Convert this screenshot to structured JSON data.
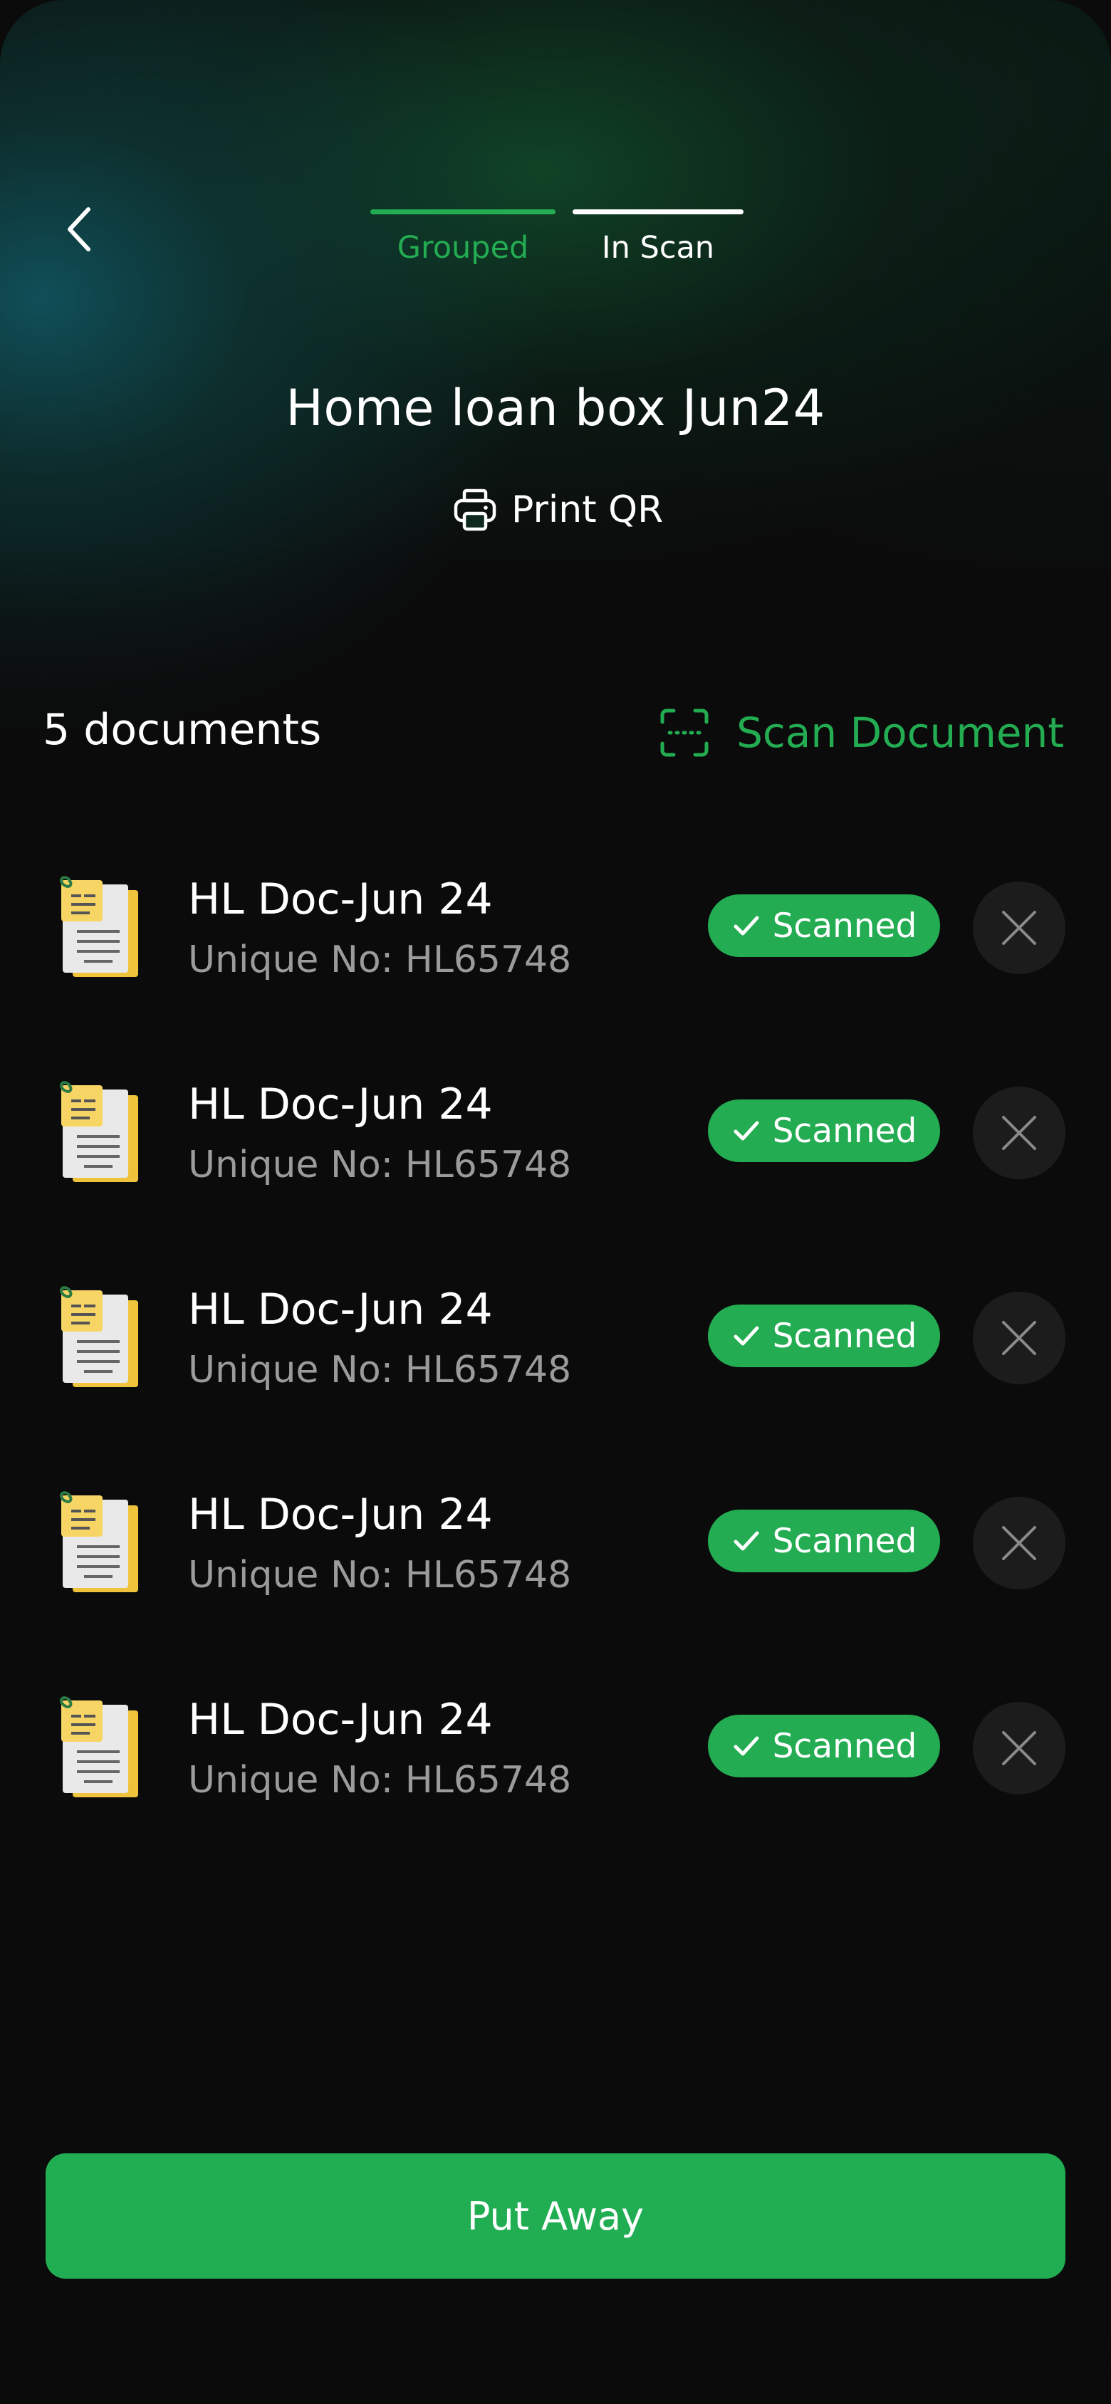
{
  "nav": {
    "back_icon": "chevron-left-icon",
    "tabs": [
      {
        "label": "Grouped",
        "state": "completed"
      },
      {
        "label": "In Scan",
        "state": "active"
      }
    ]
  },
  "box": {
    "title": "Home loan box Jun24",
    "print_qr_label": "Print QR",
    "print_icon": "printer-icon"
  },
  "documents": {
    "count_label": "5 documents",
    "scan_label": "Scan Document",
    "scan_icon": "scan-frame-icon",
    "items": [
      {
        "title": "HL Doc-Jun 24",
        "subtitle": "Unique No: HL65748",
        "status": "Scanned"
      },
      {
        "title": "HL Doc-Jun 24",
        "subtitle": "Unique No: HL65748",
        "status": "Scanned"
      },
      {
        "title": "HL Doc-Jun 24",
        "subtitle": "Unique No: HL65748",
        "status": "Scanned"
      },
      {
        "title": "HL Doc-Jun 24",
        "subtitle": "Unique No: HL65748",
        "status": "Scanned"
      },
      {
        "title": "HL Doc-Jun 24",
        "subtitle": "Unique No: HL65748",
        "status": "Scanned"
      }
    ]
  },
  "footer": {
    "put_away_label": "Put Away"
  },
  "colors": {
    "accent": "#23ac52",
    "background": "#0b0b0b",
    "muted_text": "#9b9b9b",
    "button_dark": "#1c1c1c"
  }
}
